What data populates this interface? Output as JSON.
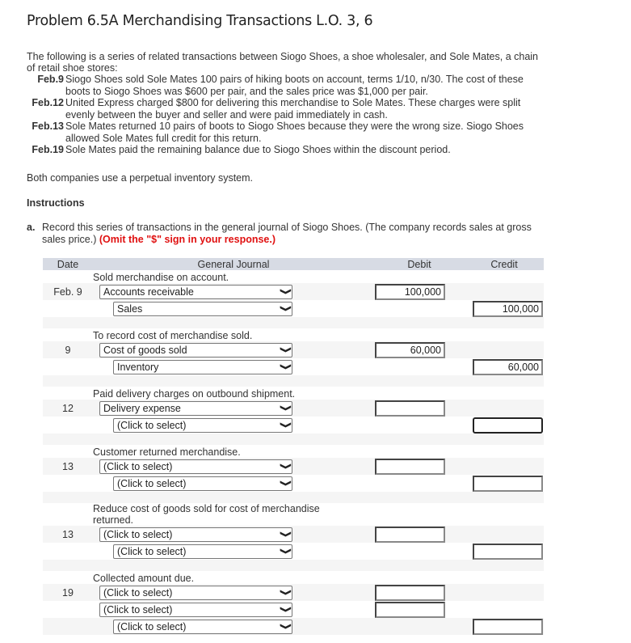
{
  "title": "Problem 6.5A Merchandising Transactions L.O. 3, 6",
  "intro": "The following is a series of related transactions between Siogo Shoes, a shoe wholesaler, and Sole Mates, a chain of retail shoe stores:",
  "transactions": [
    {
      "date": "Feb.9",
      "text": "Siogo Shoes sold Sole Mates 100 pairs of hiking boots on account, terms 1/10, n/30. The cost of these boots to Siogo Shoes was $600 per pair, and the sales price was $1,000 per pair."
    },
    {
      "date": "Feb.12",
      "text": "United Express charged $800 for delivering this merchandise to Sole Mates. These charges were split evenly between the buyer and seller and were paid immediately in cash."
    },
    {
      "date": "Feb.13",
      "text": "Sole Mates returned 10 pairs of boots to Siogo Shoes because they were the wrong size. Siogo Shoes allowed Sole Mates full credit for this return."
    },
    {
      "date": "Feb.19",
      "text": "Sole Mates paid the remaining balance due to Siogo Shoes within the discount period."
    }
  ],
  "inventory_note": "Both companies use a perpetual inventory system.",
  "instructions_heading": "Instructions",
  "part_a": {
    "label": "a.",
    "text": "Record this series of transactions in the general journal of Siogo Shoes. (The company records sales at gross sales price.)",
    "warning": "(Omit the \"$\" sign in your response.)"
  },
  "journal": {
    "headers": {
      "date": "Date",
      "journal": "General Journal",
      "debit": "Debit",
      "credit": "Credit"
    },
    "entries": [
      {
        "note": "Sold merchandise on account.",
        "date": "Feb. 9",
        "lines": [
          {
            "account": "Accounts receivable",
            "debit": "100,000"
          },
          {
            "account": "Sales",
            "credit": "100,000"
          }
        ]
      },
      {
        "note": "To record cost of merchandise sold.",
        "date": "9",
        "lines": [
          {
            "account": "Cost of goods sold",
            "debit": "60,000"
          },
          {
            "account": "Inventory",
            "credit": "60,000"
          }
        ]
      },
      {
        "note": "Paid delivery charges on outbound shipment.",
        "date": "12",
        "lines": [
          {
            "account": "Delivery expense",
            "debit": ""
          },
          {
            "account": "(Click to select)",
            "credit": ""
          }
        ]
      },
      {
        "note": "Customer returned merchandise.",
        "date": "13",
        "lines": [
          {
            "account": "(Click to select)",
            "debit": ""
          },
          {
            "account": "(Click to select)",
            "credit": ""
          }
        ]
      },
      {
        "note": "Reduce cost of goods sold for cost of merchandise returned.",
        "date": "13",
        "lines": [
          {
            "account": "(Click to select)",
            "debit": ""
          },
          {
            "account": "(Click to select)",
            "credit": ""
          }
        ]
      },
      {
        "note": "Collected amount due.",
        "date": "19",
        "lines": [
          {
            "account": "(Click to select)",
            "debit": ""
          },
          {
            "account": "(Click to select)",
            "debit": ""
          },
          {
            "account": "(Click to select)",
            "credit": ""
          }
        ]
      }
    ]
  }
}
